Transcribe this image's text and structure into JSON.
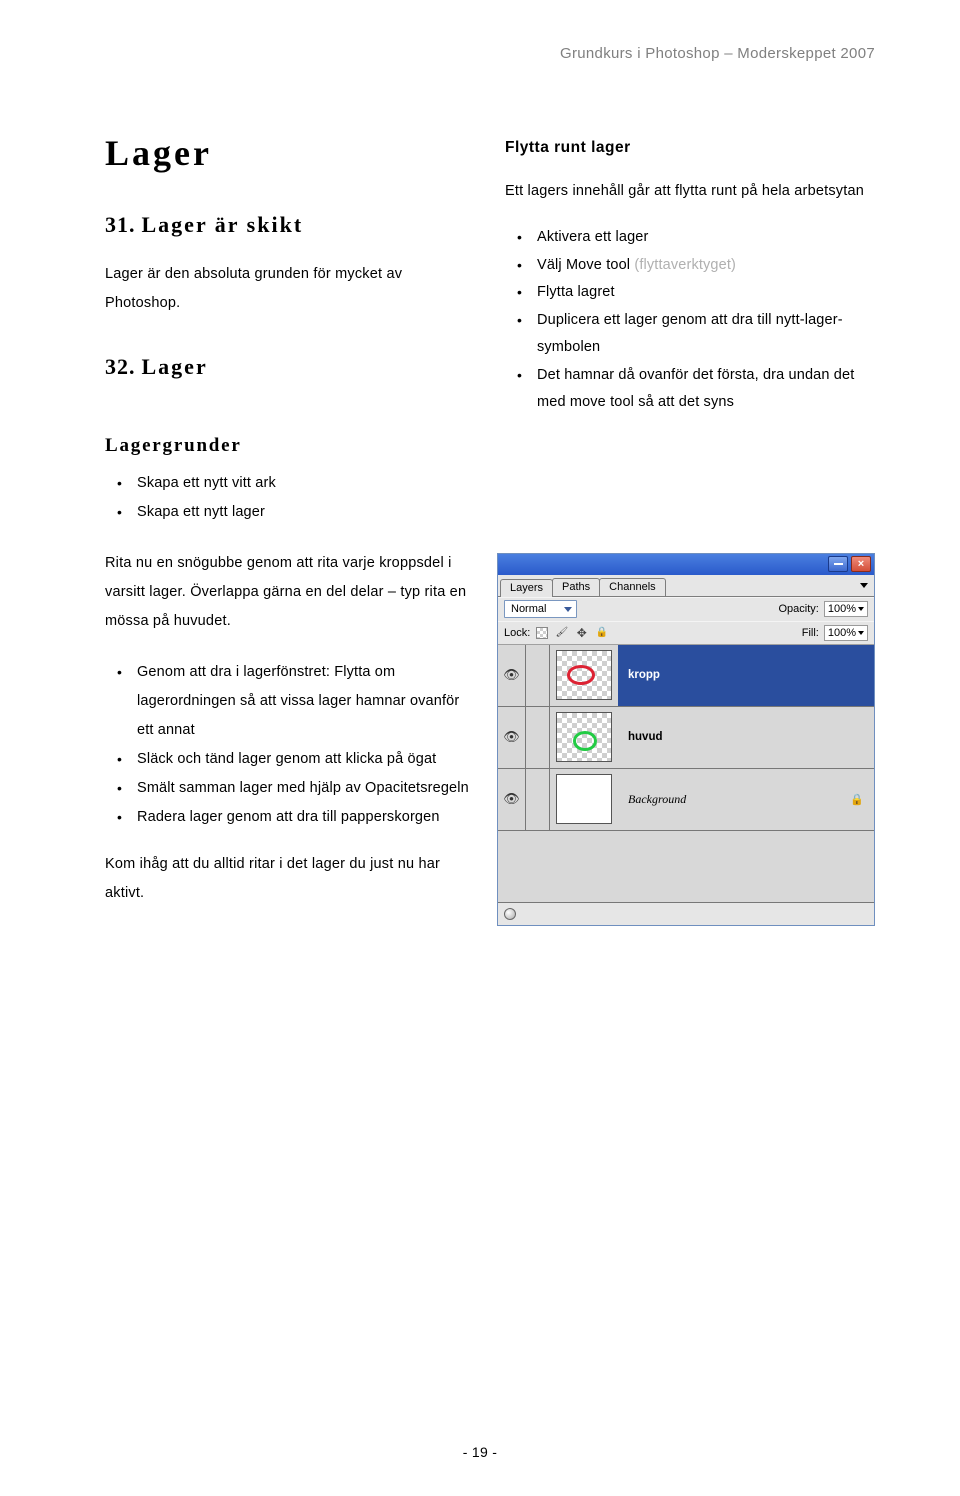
{
  "header": "Grundkurs i Photoshop – Moderskeppet 2007",
  "footer_page": "- 19 -",
  "left": {
    "h1": "Lager",
    "s31_num": "31.",
    "s31_title": "Lager är skikt",
    "s31_para": "Lager är den absoluta grunden för mycket av Photoshop.",
    "s32_num": "32.",
    "s32_title": "Lager",
    "grunder_h": "Lagergrunder",
    "grunder_items": [
      "Skapa ett nytt vitt ark",
      "Skapa ett nytt lager"
    ],
    "snogubbe_para": "Rita nu en snögubbe genom att rita varje kroppsdel i varsitt lager. Överlappa gärna en del delar – typ rita en mössa på huvudet.",
    "mid_items": [
      "Genom att dra i lagerfönstret: Flytta om lagerordningen så att vissa lager hamnar ovanför ett annat",
      "Släck och tänd lager genom att klicka på ögat",
      "Smält samman lager med hjälp av Opacitetsregeln",
      "Radera lager genom att dra till papperskorgen"
    ],
    "kom_ihag": "Kom ihåg att du alltid ritar i det lager du just nu har aktivt."
  },
  "right": {
    "flytta_h": "Flytta runt lager",
    "flytta_para": "Ett lagers innehåll går att flytta runt på hela arbetsytan",
    "bullets": [
      {
        "text": "Aktivera ett lager"
      },
      {
        "text_a": "Välj Move tool ",
        "text_grey": "(flyttaverktyget)"
      },
      {
        "text": "Flytta lagret"
      },
      {
        "text": "Duplicera ett lager genom att dra till nytt-lager-symbolen"
      },
      {
        "text": "Det hamnar då ovanför det första, dra undan det med move tool så att det syns"
      }
    ]
  },
  "panel": {
    "tabs": [
      "Layers",
      "Paths",
      "Channels"
    ],
    "blend_mode": "Normal",
    "opacity_lbl": "Opacity:",
    "opacity_val": "100%",
    "lock_lbl": "Lock:",
    "fill_lbl": "Fill:",
    "fill_val": "100%",
    "rows": [
      {
        "name": "kropp",
        "selected": true,
        "ring": "red"
      },
      {
        "name": "huvud",
        "selected": false,
        "ring": "green"
      },
      {
        "name": "Background",
        "selected": false,
        "bg": true
      }
    ]
  }
}
